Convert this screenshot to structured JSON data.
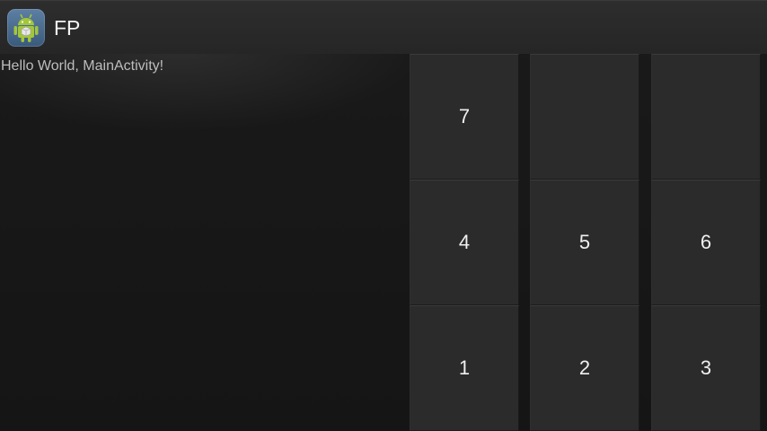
{
  "action_bar": {
    "title": "FP",
    "icon": "android-launcher-icon"
  },
  "main": {
    "hello_text": "Hello World, MainActivity!"
  },
  "keypad": {
    "rows": [
      [
        "7",
        "",
        ""
      ],
      [
        "4",
        "5",
        "6"
      ],
      [
        "1",
        "2",
        "3"
      ]
    ]
  },
  "colors": {
    "background": "#141414",
    "key": "#2b2b2b",
    "text": "#f0f0f0",
    "android_green": "#a4c639"
  }
}
